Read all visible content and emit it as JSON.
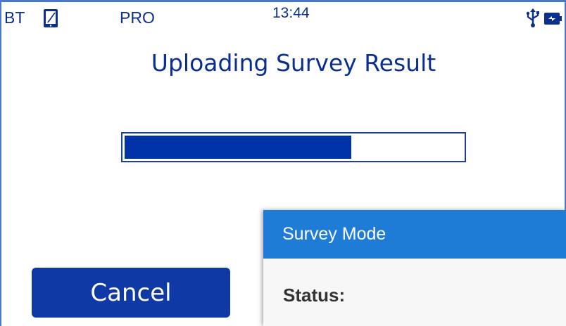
{
  "status_bar": {
    "bt_label": "BT",
    "mode_label": "PRO",
    "time": "13:44",
    "icons": [
      "tablet-icon",
      "usb-icon",
      "battery-charging-icon"
    ]
  },
  "title": "Uploading Survey Result",
  "progress": {
    "fraction": 0.67
  },
  "cancel_button": {
    "label": "Cancel"
  },
  "dialog": {
    "title": "Survey Mode",
    "status_label": "Status:"
  },
  "colors": {
    "primary": "#0a2f8f",
    "progress_fill": "#0033a8",
    "button": "#0f3aa6",
    "dialog_header": "#1e7bd6"
  }
}
